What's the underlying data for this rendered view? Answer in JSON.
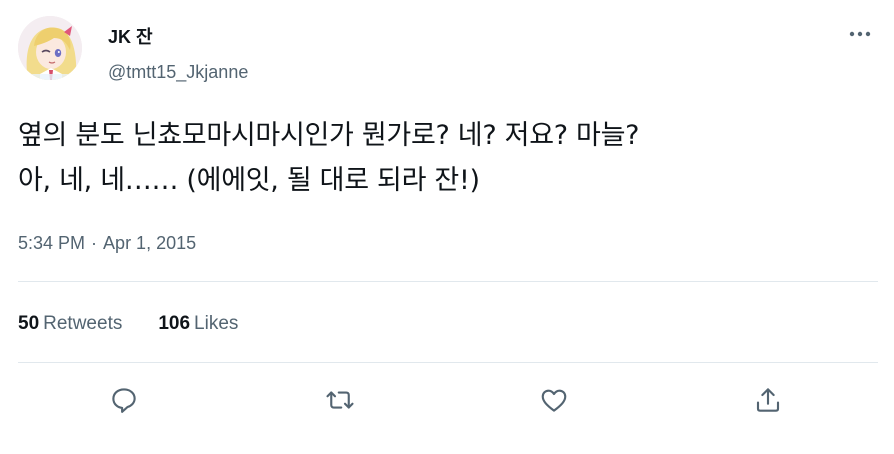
{
  "author": {
    "display_name": "JK 잔",
    "handle": "@tmtt15_Jkjanne",
    "avatar_icon": "anime-avatar"
  },
  "tweet": {
    "text": "옆의 분도 닌쵸모마시마시인가 뭔가로? 네? 저요? 마늘?\n아, 네, 네…… (에에잇, 될 대로 되라 잔!)",
    "time": "5:34 PM",
    "separator": "·",
    "date": "Apr 1, 2015"
  },
  "stats": {
    "retweets_count": "50",
    "retweets_label": "Retweets",
    "likes_count": "106",
    "likes_label": "Likes"
  },
  "actions": [
    "reply-icon",
    "retweet-icon",
    "like-icon",
    "share-icon"
  ],
  "colors": {
    "text_primary": "#0f1419",
    "text_secondary": "#536471",
    "divider": "#e1e8ed"
  }
}
